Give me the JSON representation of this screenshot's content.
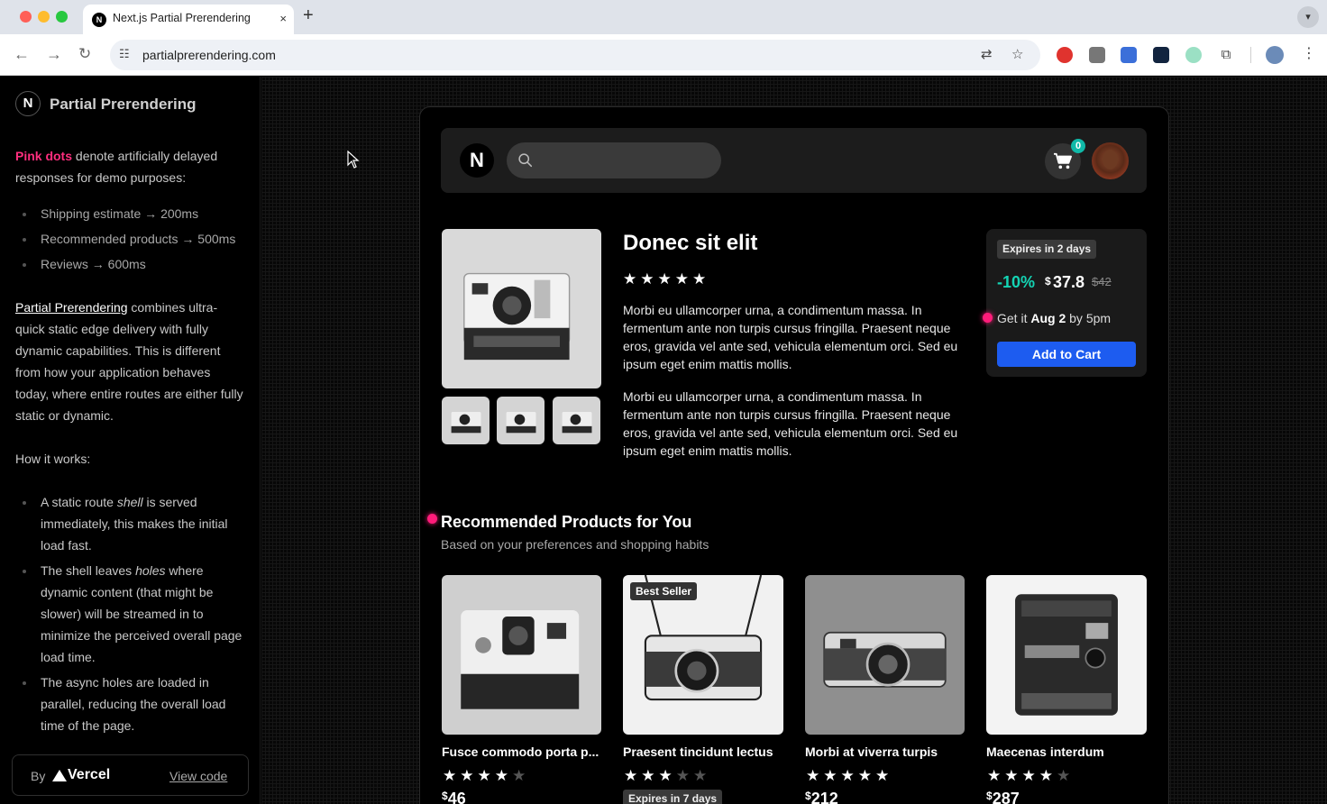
{
  "browser": {
    "tab_title": "Next.js Partial Prerendering",
    "tab_favicon": "N",
    "new_tab": "+",
    "close_tab": "×",
    "url": "partialprerendering.com"
  },
  "sidebar": {
    "logo": "N",
    "title": "Partial Prerendering",
    "intro_highlight": "Pink dots",
    "intro_rest": " denote artificially delayed responses for demo purposes:",
    "delays": [
      "Shipping estimate → 200ms",
      "Recommended products → 500ms",
      "Reviews → 600ms"
    ],
    "ppr_link": "Partial Prerendering",
    "ppr_rest": " combines ultra-quick static edge delivery with fully dynamic capabilities. This is different from how your application behaves today, where entire routes are either fully static or dynamic.",
    "how_heading": "How it works:",
    "how_items": [
      {
        "pre": "A static route ",
        "em": "shell",
        "post": " is served immediately, this makes the initial load fast."
      },
      {
        "pre": "The shell leaves ",
        "em": "holes",
        "post": " where dynamic content (that might be slower) will be streamed in to minimize the perceived overall page load time."
      },
      {
        "pre": "The async holes are loaded in parallel, reducing the overall load time of the page.",
        "em": "",
        "post": ""
      }
    ],
    "footer_by": "By",
    "footer_brand": "Vercel",
    "footer_link": "View code"
  },
  "header": {
    "logo": "N",
    "cart_count": "0"
  },
  "product": {
    "title": "Donec sit elit",
    "rating": 5,
    "desc_1": "Morbi eu ullamcorper urna, a condimentum massa. In fermentum ante non turpis cursus fringilla. Praesent neque eros, gravida vel ante sed, vehicula elementum orci. Sed eu ipsum eget enim mattis mollis.",
    "desc_2": "Morbi eu ullamcorper urna, a condimentum massa. In fermentum ante non turpis cursus fringilla. Praesent neque eros, gravida vel ante sed, vehicula elementum orci. Sed eu ipsum eget enim mattis mollis."
  },
  "buybox": {
    "expires": "Expires in 2 days",
    "discount": "-10%",
    "currency": "$",
    "price": "37.8",
    "old_price": "$42",
    "delivery_pre": "Get it ",
    "delivery_date": "Aug 2",
    "delivery_post": " by 5pm",
    "button": "Add to Cart"
  },
  "recommended": {
    "title": "Recommended Products for You",
    "subtitle": "Based on your preferences and shopping habits",
    "items": [
      {
        "name": "Fusce commodo porta p...",
        "rating": 4,
        "price": "46",
        "badge": "",
        "expires": ""
      },
      {
        "name": "Praesent tincidunt lectus",
        "rating": 3,
        "price": "",
        "badge": "Best Seller",
        "expires": "Expires in 7 days"
      },
      {
        "name": "Morbi at viverra turpis",
        "rating": 5,
        "price": "212",
        "badge": "",
        "expires": ""
      },
      {
        "name": "Maecenas interdum",
        "rating": 4,
        "price": "287",
        "badge": "",
        "expires": ""
      }
    ]
  },
  "colors": {
    "accent_pink": "#ff1c7a",
    "discount_teal": "#14d4b4",
    "button_blue": "#1d5cf0",
    "cart_badge": "#10b9a8"
  },
  "icons": {
    "search": "search-icon",
    "cart": "cart-icon",
    "star": "star-icon",
    "camera": "camera-photo"
  }
}
